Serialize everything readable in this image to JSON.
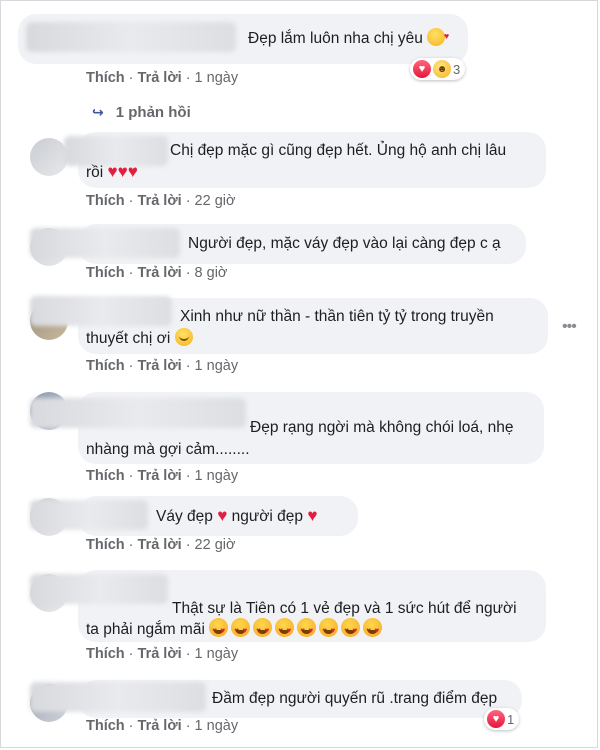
{
  "actions": {
    "like": "Thích",
    "reply": "Trả lời"
  },
  "comments": [
    {
      "text": "Đẹp lắm luôn nha chị yêu",
      "time": "1 ngày",
      "reaction_count": "3",
      "replies_link": "1 phản hồi"
    },
    {
      "line1": "Chị đẹp mặc gì cũng đẹp hết. Ủng hộ anh chị lâu",
      "line2": "rồi",
      "time": "22 giờ"
    },
    {
      "text": "Người đẹp, mặc váy đẹp vào lại càng đẹp c ạ",
      "time": "8 giờ"
    },
    {
      "line1": "Xinh như nữ thần - thần tiên tỷ tỷ trong truyền",
      "line2": "thuyết chị ơi",
      "time": "1 ngày"
    },
    {
      "line1": "Đẹp rạng ngời mà không chói loá, nhẹ",
      "line2": "nhàng mà gợi cảm........",
      "time": "1 ngày"
    },
    {
      "part1": "Váy đẹp",
      "part2": "người đẹp",
      "time": "22 giờ"
    },
    {
      "line1": "Thật sự là Tiên có 1 vẻ đẹp và 1 sức hút để người",
      "line2": "ta phải ngắm mãi",
      "time": "1 ngày"
    },
    {
      "text": "Đầm đẹp người quyến rũ .trang điểm đẹp",
      "time": "1 ngày",
      "reaction_count": "1"
    }
  ],
  "colors": {
    "bubble": "#f0f2f5",
    "meta_text": "#65676b",
    "heart": "#e41e3f"
  }
}
